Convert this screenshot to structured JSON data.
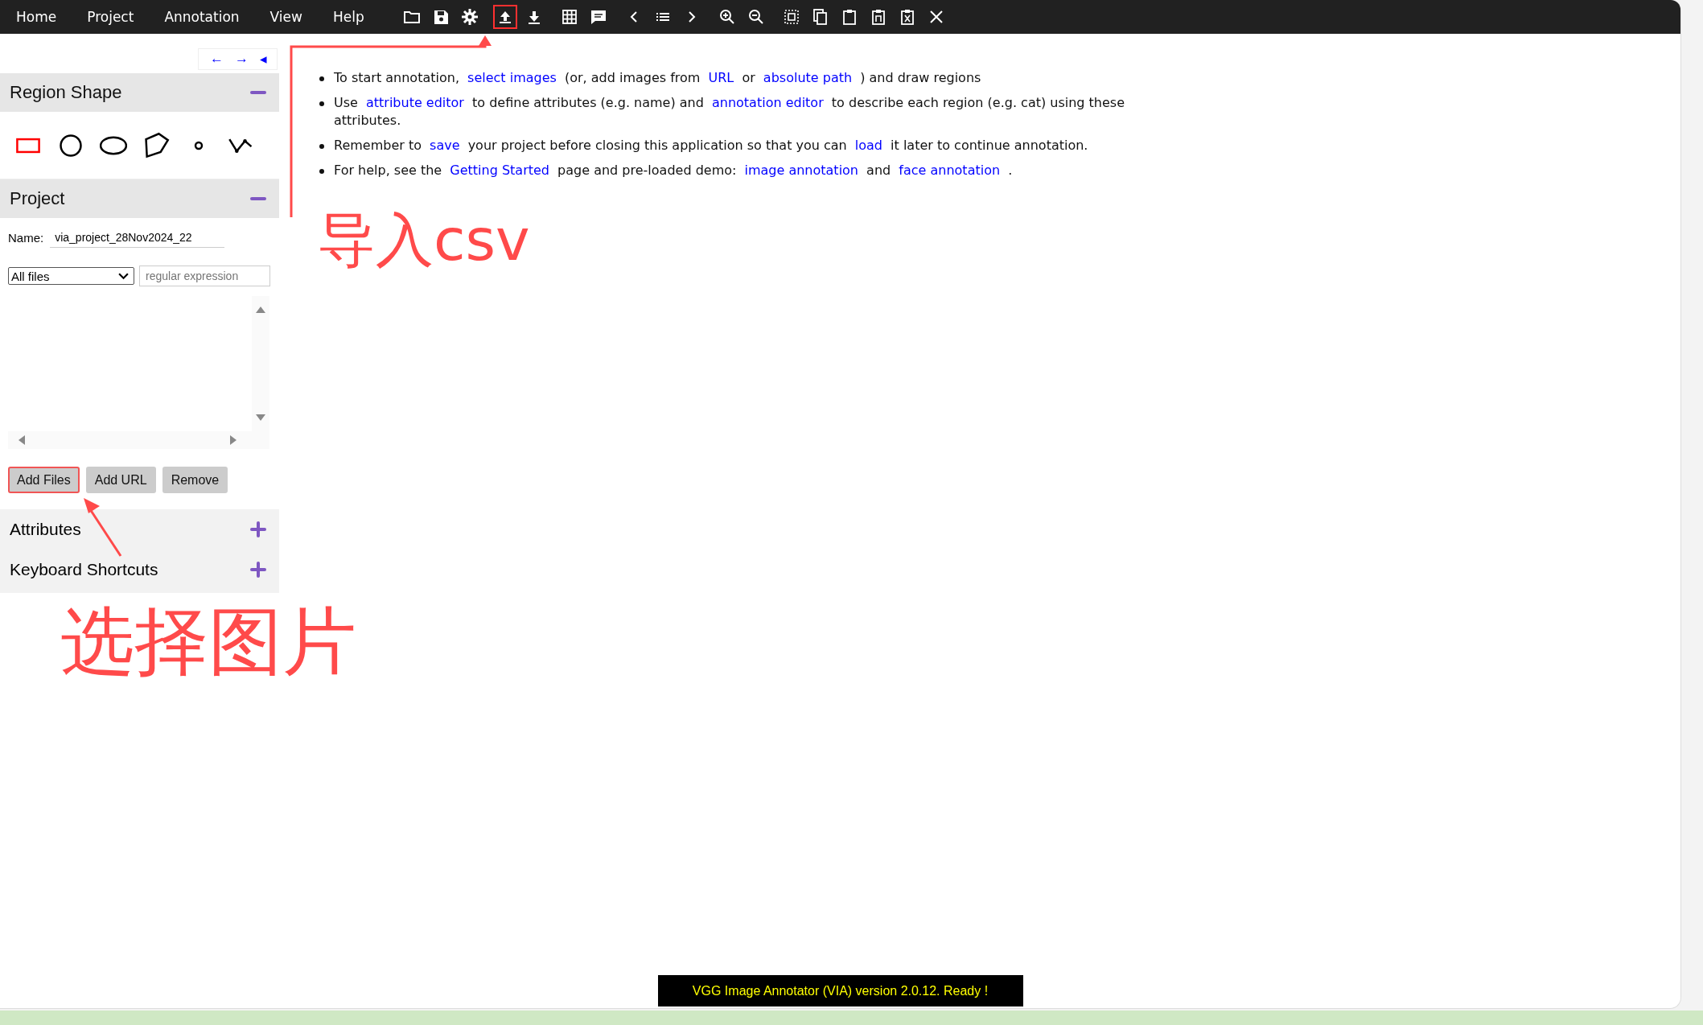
{
  "menu": [
    "Home",
    "Project",
    "Annotation",
    "View",
    "Help"
  ],
  "toolbar_groups": [
    [
      {
        "kind": "folder",
        "highlighted": false
      },
      {
        "kind": "save",
        "highlighted": false
      },
      {
        "kind": "gear",
        "highlighted": false
      }
    ],
    [
      {
        "kind": "upload",
        "highlighted": true
      },
      {
        "kind": "download",
        "highlighted": false
      }
    ],
    [
      {
        "kind": "grid",
        "highlighted": false
      },
      {
        "kind": "comment",
        "highlighted": false
      }
    ],
    [
      {
        "kind": "prev",
        "highlighted": false
      },
      {
        "kind": "list",
        "highlighted": false
      },
      {
        "kind": "next",
        "highlighted": false
      }
    ],
    [
      {
        "kind": "zoom-in",
        "highlighted": false
      },
      {
        "kind": "zoom-out",
        "highlighted": false
      }
    ],
    [
      {
        "kind": "select-all",
        "highlighted": false
      },
      {
        "kind": "copy",
        "highlighted": false
      },
      {
        "kind": "paste",
        "highlighted": false
      },
      {
        "kind": "paste-n",
        "highlighted": false
      },
      {
        "kind": "clipboard-x",
        "highlighted": false
      },
      {
        "kind": "close",
        "highlighted": false
      }
    ]
  ],
  "nav_arrows": [
    "←",
    "→",
    "◂"
  ],
  "region_shape": {
    "title": "Region Shape",
    "expanded": true,
    "shapes": [
      {
        "kind": "rect",
        "selected": true
      },
      {
        "kind": "circle",
        "selected": false
      },
      {
        "kind": "ellipse",
        "selected": false
      },
      {
        "kind": "polygon",
        "selected": false
      },
      {
        "kind": "point",
        "selected": false
      },
      {
        "kind": "polyline",
        "selected": false
      }
    ]
  },
  "project": {
    "title": "Project",
    "expanded": true,
    "name_label": "Name:",
    "name_value": "via_project_28Nov2024_22",
    "filter": "All files",
    "regex_placeholder": "regular expression",
    "buttons": [
      {
        "label": "Add Files",
        "highlighted": true
      },
      {
        "label": "Add URL",
        "highlighted": false
      },
      {
        "label": "Remove",
        "highlighted": false
      }
    ]
  },
  "collapsed_panels": [
    {
      "title": "Attributes",
      "expanded": false
    },
    {
      "title": "Keyboard Shortcuts",
      "expanded": false
    }
  ],
  "bullets": [
    [
      {
        "text": "To start annotation,",
        "link": false
      },
      {
        "text": "select images",
        "link": true
      },
      {
        "text": "(or, add images from",
        "link": false
      },
      {
        "text": "URL",
        "link": true
      },
      {
        "text": "or",
        "link": false
      },
      {
        "text": "absolute path",
        "link": true
      },
      {
        "text": ") and draw regions",
        "link": false
      }
    ],
    [
      {
        "text": "Use",
        "link": false
      },
      {
        "text": "attribute editor",
        "link": true
      },
      {
        "text": "to define attributes (e.g. name) and",
        "link": false
      },
      {
        "text": "annotation editor",
        "link": true
      },
      {
        "text": "to describe each region (e.g. cat) using these attributes.",
        "link": false
      }
    ],
    [
      {
        "text": "Remember to",
        "link": false
      },
      {
        "text": "save",
        "link": true
      },
      {
        "text": "your project before closing this application so that you can",
        "link": false
      },
      {
        "text": "load",
        "link": true
      },
      {
        "text": "it later to continue annotation.",
        "link": false
      }
    ],
    [
      {
        "text": "For help, see the",
        "link": false
      },
      {
        "text": "Getting Started",
        "link": true
      },
      {
        "text": "page and pre-loaded demo:",
        "link": false
      },
      {
        "text": "image annotation",
        "link": true
      },
      {
        "text": "and",
        "link": false
      },
      {
        "text": "face annotation",
        "link": true
      },
      {
        "text": ".",
        "link": false
      }
    ]
  ],
  "status": "VGG Image Annotator (VIA) version 2.0.12. Ready !",
  "annotations": [
    {
      "text": "导入csv"
    },
    {
      "text": "选择图片"
    }
  ]
}
